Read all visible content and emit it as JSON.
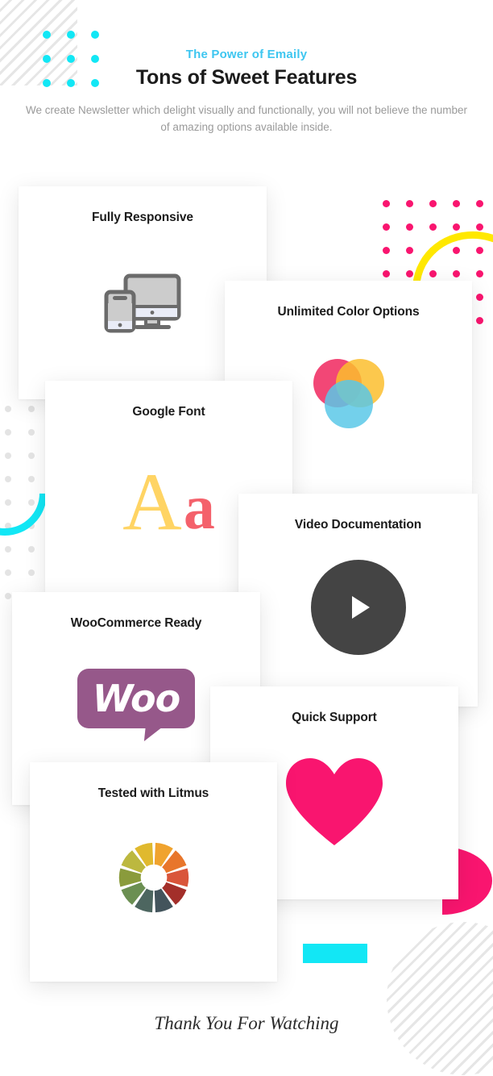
{
  "header": {
    "eyebrow": "The Power of Emaily",
    "headline": "Tons of Sweet Features",
    "subcopy": "We create Newsletter which delight visually and functionally, you will not believe the number of amazing options available inside."
  },
  "cards": [
    {
      "title": "Fully Responsive",
      "icon": "devices-icon"
    },
    {
      "title": "Unlimited Color Options",
      "icon": "color-circles-icon"
    },
    {
      "title": "Google Font",
      "icon": "aa-typography-icon"
    },
    {
      "title": "Video Documentation",
      "icon": "play-button-icon"
    },
    {
      "title": "WooCommerce Ready",
      "icon": "woocommerce-logo-icon"
    },
    {
      "title": "Quick Support",
      "icon": "heart-icon"
    },
    {
      "title": "Tested with Litmus",
      "icon": "litmus-color-wheel-icon"
    }
  ],
  "footer": {
    "text": "Thank You For Watching"
  },
  "icon_text": {
    "woo": "Woo",
    "font_upper": "A",
    "font_lower": "a"
  },
  "colors": {
    "accent_cyan": "#12e7f5",
    "eyebrow_cyan": "#3ec6f0",
    "accent_pink": "#f9156f",
    "accent_yellow": "#ffe800",
    "heading": "#1b1b1b",
    "body_text": "#9a9a9a",
    "stripe_gray": "#e6e6e6",
    "dot_gray": "#e4e4e4",
    "woo_purple": "#96588a",
    "play_dark": "#444444",
    "font_yellow": "#ffd464",
    "font_red": "#f4616b",
    "venn_pink": "#f0275e",
    "venn_yellow": "#fbbe2e",
    "venn_cyan": "#5ac8e8"
  }
}
